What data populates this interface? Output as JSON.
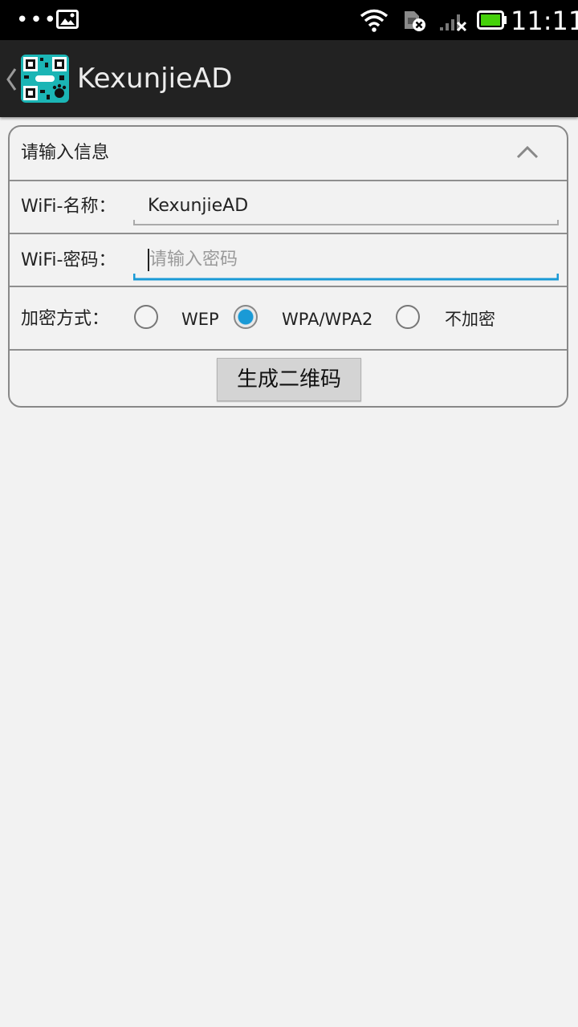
{
  "status_bar": {
    "time": "11:11",
    "dots": "•••",
    "icons": [
      "image-notification-icon",
      "wifi-icon",
      "sim-error-icon",
      "signal-icon",
      "battery-icon"
    ]
  },
  "action_bar": {
    "title": "KexunjieAD",
    "back_icon": "chevron-left-icon",
    "app_icon": "qr-code-app-icon"
  },
  "form": {
    "section_title": "请输入信息",
    "collapse_icon": "chevron-up-icon",
    "ssid_label": "WiFi-名称：",
    "ssid_value": "KexunjieAD",
    "password_label": "WiFi-密码：",
    "password_value": "",
    "password_placeholder": "请输入密码",
    "encryption_label": "加密方式：",
    "encryption_options": [
      {
        "label": "WEP",
        "checked": false
      },
      {
        "label": "WPA/WPA2",
        "checked": true
      },
      {
        "label": "不加密",
        "checked": false
      }
    ],
    "generate_button": "生成二维码"
  },
  "colors": {
    "accent": "#1a9ad6",
    "action_bar": "#222222",
    "background": "#f2f2f2",
    "battery_fill": "#45d10a"
  }
}
